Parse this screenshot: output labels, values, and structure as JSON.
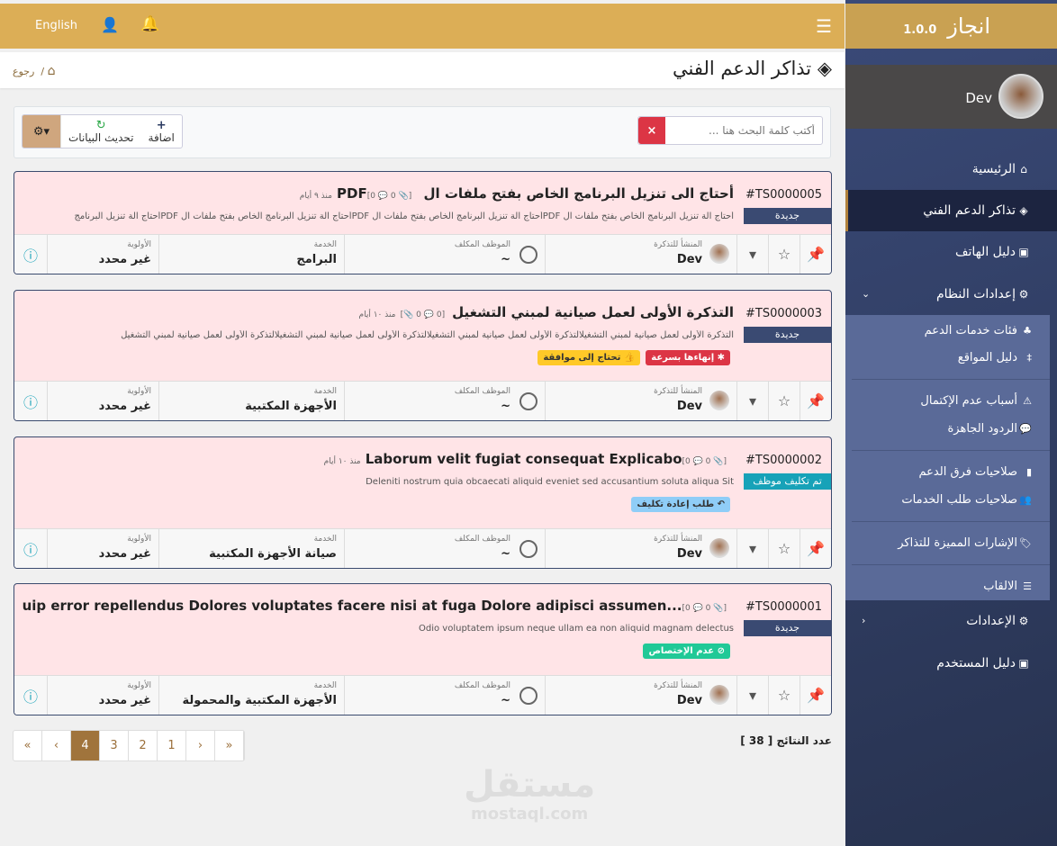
{
  "topbar": {
    "language": "English",
    "menu_icon": "hamburger-icon",
    "user_icon": "user-icon",
    "bell_icon": "bell-icon"
  },
  "page": {
    "title": "تذاكر الدعم الفني",
    "back": "رجوع",
    "separator": "/"
  },
  "toolbar": {
    "search_placeholder": "أكتب كلمة البحث هنا ...",
    "search_value": "",
    "clear": "×",
    "add": "اضافة",
    "refresh": "تحديث البيانات",
    "settings": "⚙▾"
  },
  "labels": {
    "creator": "المنشأ للتذكرة",
    "employee": "الموظف المكلف",
    "service": "الخدمة",
    "priority": "الأولوية"
  },
  "tickets": [
    {
      "id": "#TS0000005",
      "status": "جديدة",
      "status_color": "#3a4a72",
      "title": "أحتاج الى تنزيل البرنامج الخاص بفتح ملفات ال PDF",
      "meta": "[0 💬 0 📎]",
      "age": "منذ ٩ أيام",
      "desc": "أحتاج الة تنزيل البرنامج الخاص بفتح ملفات ال PDFأحتاج الة تنزيل البرنامج الخاص بفتح ملفات ال PDFأحتاج الة تنزيل البرنامج الخاص بفتح ملفات ال PDFأحتاج الة تنزيل البرنامج",
      "tags": [],
      "creator": "Dev",
      "employee": "~",
      "service": "البرامج",
      "priority": "غير محدد"
    },
    {
      "id": "#TS0000003",
      "status": "جديدة",
      "status_color": "#3a4a72",
      "title": "التذكرة الأولى لعمل صيانية لمبني التشغيل",
      "meta": "[0 💬 0 📎]",
      "age": "منذ ١٠ أيام",
      "desc": "التذكرة الأولى لعمل صيانية لمبني التشغيلالتذكرة الأولى لعمل صيانية لمبني التشغيلالتذكرة الأولى لعمل صيانية لمبني التشغيلالتذكرة الأولى لعمل صيانية لمبني التشغيل",
      "tags": [
        {
          "label": "✱ إنهاءها بسرعة",
          "bg": "#dc3545",
          "fg": "#fff"
        },
        {
          "label": "👍 تحتاج إلى موافقة",
          "bg": "#ffc928",
          "fg": "#333"
        }
      ],
      "creator": "Dev",
      "employee": "~",
      "service": "الأجهزة المكتبية",
      "priority": "غير محدد"
    },
    {
      "id": "#TS0000002",
      "status": "تم تكليف موظف",
      "status_color": "#17a2b8",
      "title": "Laborum velit fugiat consequat Explicabo",
      "meta": "[0 💬 0 📎]",
      "age": "منذ ١٠ أيام",
      "desc": "Deleniti nostrum quia obcaecati aliquid eveniet sed accusantium soluta aliqua Sit",
      "tags": [
        {
          "label": "↶ طلب إعادة تكليف",
          "bg": "#8fcdf7",
          "fg": "#333"
        }
      ],
      "creator": "Dev",
      "employee": "~",
      "service": "صيانة الأجهزة المكتبية",
      "priority": "غير محدد"
    },
    {
      "id": "#TS0000001",
      "status": "جديدة",
      "status_color": "#3a4a72",
      "title": "dunt aliquip error repellendus Dolores voluptates facere nisi at fuga Dolore adipisci assumen...",
      "meta": "[0 💬 0 📎]",
      "age": "منذ ١٠ أيام",
      "desc": "Odio voluptatem ipsum neque ullam ea non aliquid magnam delectus",
      "tags": [
        {
          "label": "⊘ عدم الإختصاص",
          "bg": "#20c997",
          "fg": "#fff"
        }
      ],
      "creator": "Dev",
      "employee": "~",
      "service": "الأجهزة المكتبية والمحمولة",
      "priority": "غير محدد"
    }
  ],
  "pagination": {
    "pages": [
      "«",
      "‹",
      "4",
      "3",
      "2",
      "1",
      "›",
      "»"
    ],
    "current": "4",
    "count_label": "عدد النتائج [ 38 ]"
  },
  "watermark": {
    "ar": "مستقل",
    "en": "mostaql.com"
  },
  "sidebar": {
    "brand": "انجاز",
    "version": "1.0.0",
    "user": "Dev",
    "items": [
      {
        "label": "الرئيسية",
        "icon": "⌂"
      },
      {
        "label": "تذاكر الدعم الفني",
        "icon": "◈"
      },
      {
        "label": "دليل الهاتف",
        "icon": "▣"
      },
      {
        "label": "إعدادات النظام",
        "icon": "⚙",
        "chev": "⌄"
      }
    ],
    "sub": [
      {
        "label": "فئات خدمات الدعم",
        "icon": "♣"
      },
      {
        "label": "دليل المواقع",
        "icon": "‡"
      },
      {
        "label": "أسباب عدم الإكتمال",
        "icon": "⚠"
      },
      {
        "label": "الردود الجاهزة",
        "icon": "💬"
      },
      {
        "label": "صلاحيات فرق الدعم",
        "icon": "▮"
      },
      {
        "label": "صلاحيات طلب الخدمات",
        "icon": "👥"
      },
      {
        "label": "الإشارات المميزة للتذاكر",
        "icon": "🏷"
      },
      {
        "label": "الالقاب",
        "icon": "☰"
      }
    ],
    "bottom": [
      {
        "label": "الإعدادات",
        "icon": "⚙",
        "chev": "‹"
      },
      {
        "label": "دليل المستخدم",
        "icon": "▣"
      }
    ]
  }
}
